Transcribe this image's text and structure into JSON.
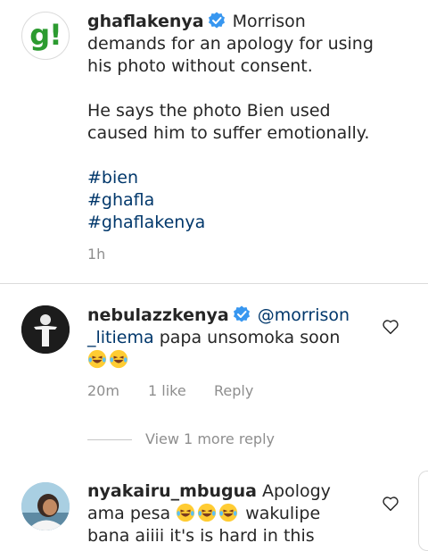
{
  "post": {
    "username": "ghaflakenya",
    "avatar_letter": "g!",
    "caption_line1": "Morrison",
    "caption_line2": "demands for an apology for using",
    "caption_line3": "his photo without consent.",
    "caption_line4": "He says the photo Bien used",
    "caption_line5": "caused him to suffer emotionally.",
    "hashtags": [
      "#bien",
      "#ghafla",
      "#ghaflakenya"
    ],
    "time": "1h"
  },
  "comments": [
    {
      "username": "nebulazzkenya",
      "mention_part1": "@morrison",
      "mention_part2": "_litiema",
      "text": "papa unsomoka soon",
      "emoji_count": 2,
      "time": "20m",
      "likes": "1 like",
      "reply_label": "Reply"
    },
    {
      "username": "nyakairu_mbugua",
      "text_line1": "Apology",
      "text_line2a": "ama pesa",
      "text_line2b": "wakulipe",
      "text_line3": "bana aiiii it's is hard in this",
      "emoji_count": 3
    }
  ],
  "view_more": "View 1 more reply",
  "colors": {
    "verified": "#3897f0",
    "link": "#00376b",
    "meta": "#8e8e8e",
    "brand_green": "#2c9b30"
  }
}
